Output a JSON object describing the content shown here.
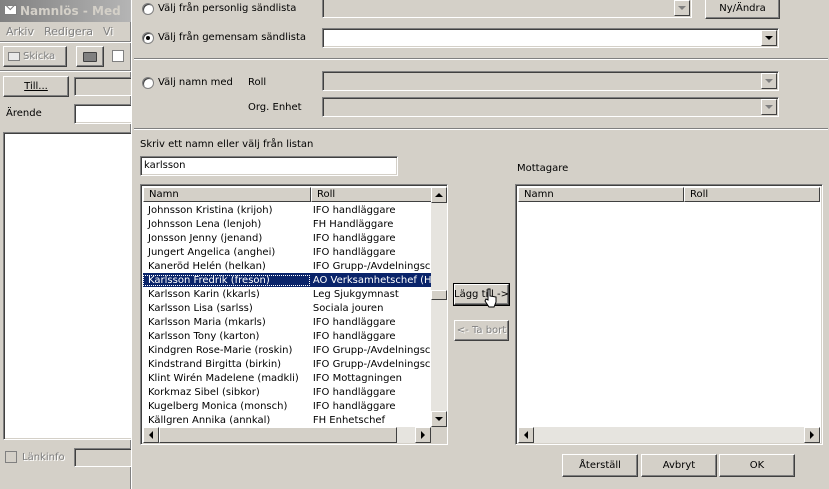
{
  "background_window": {
    "title": "Namnlös - Med",
    "menu": [
      "Arkiv",
      "Redigera",
      "Vi"
    ],
    "send_button": "Skicka",
    "to_button": "Till...",
    "subject_label": "Ärende",
    "linkinfo_label": "Länkinfo"
  },
  "dialog": {
    "personal_list_radio": "Välj från personlig sändlista",
    "personal_list_value": "",
    "new_change_button": "Ny/Ändra",
    "shared_list_radio": "Välj från gemensam sändlista",
    "shared_list_value": "",
    "choose_names_radio": "Välj namn med",
    "role_label": "Roll",
    "org_unit_label": "Org. Enhet",
    "search_label": "Skriv ett namn eller välj från listan",
    "search_value": "karlsson",
    "list_headers": {
      "name": "Namn",
      "role": "Roll"
    },
    "list_rows": [
      {
        "name": "Johnsson Kristina (krijoh)",
        "role": "IFO handläggare"
      },
      {
        "name": "Johnsson Lena (lenjoh)",
        "role": "FH Handläggare"
      },
      {
        "name": "Jonsson Jenny (jenand)",
        "role": "IFO handläggare"
      },
      {
        "name": "Jungert Angelica (anghei)",
        "role": "IFO handläggare"
      },
      {
        "name": "Kaneröd Helén (helkan)",
        "role": "IFO Grupp-/Avdelningsc"
      },
      {
        "name": "Karlsson Fredrik (freson)",
        "role": "AO Verksamhetschef (H",
        "selected": true
      },
      {
        "name": "Karlsson Karin (kkarls)",
        "role": "Leg Sjukgymnast"
      },
      {
        "name": "Karlsson Lisa (sarlss)",
        "role": "Sociala jouren"
      },
      {
        "name": "Karlsson Maria (mkarls)",
        "role": "IFO handläggare"
      },
      {
        "name": "Karlsson Tony (karton)",
        "role": "IFO handläggare"
      },
      {
        "name": "Kindgren Rose-Marie (roskin)",
        "role": "IFO Grupp-/Avdelningsc"
      },
      {
        "name": "Kindstrand Birgitta (birkin)",
        "role": "IFO Grupp-/Avdelningsc"
      },
      {
        "name": "Klint Wirén Madelene (madkli)",
        "role": "IFO Mottagningen"
      },
      {
        "name": "Korkmaz  Sibel  (sibkor)",
        "role": "IFO handläggare"
      },
      {
        "name": "Kugelberg Monica (monsch)",
        "role": "IFO handläggare"
      },
      {
        "name": "Källgren Annika (annkal)",
        "role": "FH Enhetschef"
      }
    ],
    "add_button": "Lägg till ->",
    "remove_button": "<- Ta bort",
    "recipients_label": "Mottagare",
    "recipients_headers": {
      "name": "Namn",
      "role": "Roll"
    },
    "reset_button": "Återställ",
    "cancel_button": "Avbryt",
    "ok_button": "OK"
  }
}
